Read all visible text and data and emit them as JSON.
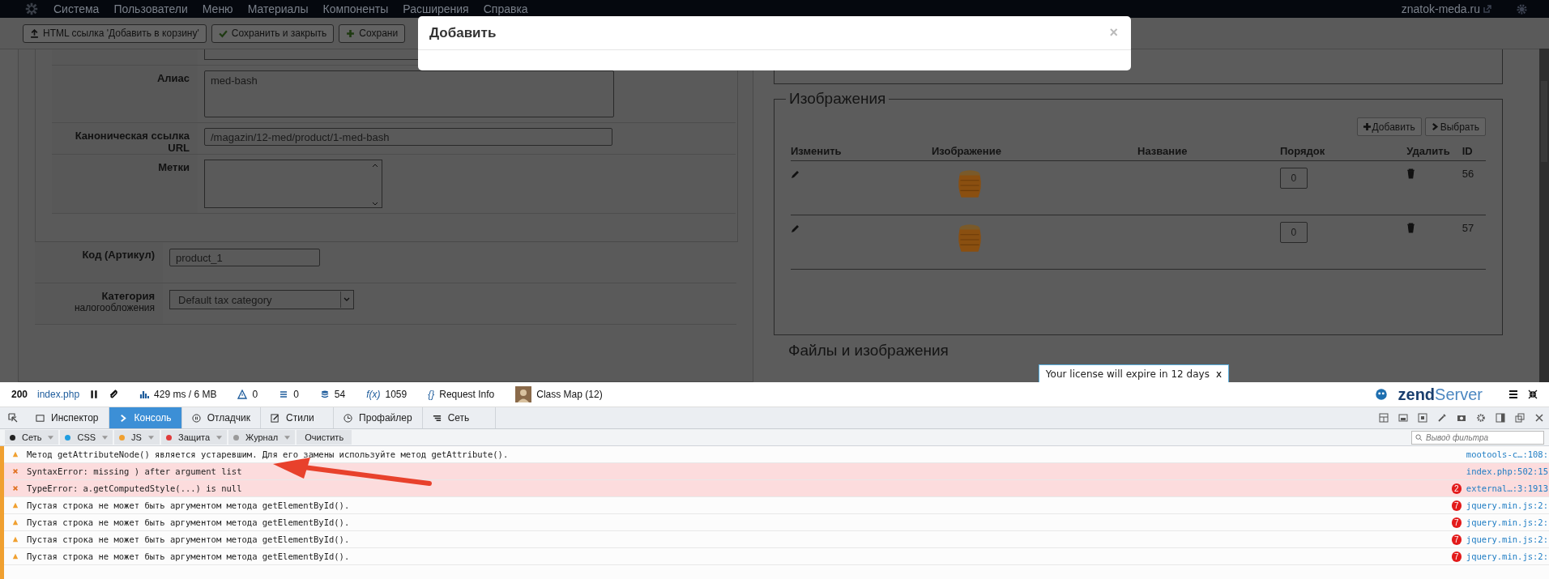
{
  "nav": {
    "menu": [
      "Система",
      "Пользователи",
      "Меню",
      "Материалы",
      "Компоненты",
      "Расширения",
      "Справка"
    ],
    "site": "znatok-meda.ru"
  },
  "toolbar": {
    "buttons": [
      {
        "kind": "upload",
        "label": "HTML ссылка 'Добавить в корзину'"
      },
      {
        "kind": "check",
        "label": "Сохранить и закрыть"
      },
      {
        "kind": "plus",
        "label": "Сохрани"
      }
    ]
  },
  "modal": {
    "title": "Добавить",
    "close": "×"
  },
  "form": {
    "inner_fields": [
      {
        "kind": "stub"
      },
      {
        "kind": "textarea",
        "label": "Алиас",
        "value": "med-bash"
      },
      {
        "kind": "input",
        "label": "Каноническая ссылка URL",
        "value": "/magazin/12-med/product/1-med-bash"
      },
      {
        "kind": "tags",
        "label": "Метки"
      }
    ],
    "fields": [
      {
        "kind": "input",
        "label": "Код (Артикул)",
        "value": "product_1"
      },
      {
        "kind": "select",
        "label": "Категория",
        "sublabel": "налогообложения",
        "value": "Default tax category"
      }
    ]
  },
  "images": {
    "legend": "Изображения",
    "buttons": [
      {
        "kind": "plus",
        "label": "Добавить"
      },
      {
        "kind": "chevron",
        "label": "Выбрать"
      }
    ],
    "columns": [
      "Изменить",
      "Изображение",
      "Название",
      "Порядок",
      "Удалить",
      "ID"
    ],
    "rows": [
      {
        "order": "0",
        "id": "56"
      },
      {
        "order": "0",
        "id": "57"
      }
    ]
  },
  "files_legend": "Файлы и изображения",
  "license_tip": {
    "text": "Your license will expire in 12 days",
    "close": "x"
  },
  "zend_bar": {
    "status": "200",
    "file": "index.php",
    "stats": [
      {
        "kind": "chart",
        "text": "429 ms / 6 MB"
      },
      {
        "kind": "warning",
        "text": "0"
      },
      {
        "kind": "list",
        "text": "0"
      },
      {
        "kind": "db",
        "text": "54"
      },
      {
        "kind": "fx",
        "icon_text": "f(x)",
        "text": "1059"
      },
      {
        "kind": "braces",
        "icon_text": "{}",
        "text": "Request Info"
      },
      {
        "kind": "avatar",
        "text": "Class Map (12)"
      }
    ],
    "logo_left": "zend",
    "logo_right": "Server"
  },
  "devtools": {
    "tabs": [
      {
        "kind": "inspector",
        "label": "Инспектор",
        "selected": false
      },
      {
        "kind": "console",
        "label": "Консоль",
        "selected": true
      },
      {
        "kind": "debug",
        "label": "Отладчик",
        "selected": false
      },
      {
        "kind": "style",
        "label": "Стили",
        "selected": false
      },
      {
        "kind": "profile",
        "label": "Профайлер",
        "selected": false
      },
      {
        "kind": "net",
        "label": "Сеть",
        "selected": false
      }
    ],
    "filters": [
      {
        "label": "Сеть",
        "color": "#222222"
      },
      {
        "label": "CSS",
        "color": "#1f9de0"
      },
      {
        "label": "JS",
        "color": "#f0a030"
      },
      {
        "label": "Защита",
        "color": "#e03b3b"
      },
      {
        "label": "Журнал",
        "color": "#9a9a9a"
      }
    ],
    "clear": "Очистить",
    "filter_placeholder": "Вывод фильтра",
    "messages": [
      {
        "kind": "warning",
        "text": "Метод getAttributeNode() является устаревшим. Для его замены используйте метод getAttribute().",
        "source": "mootools-c…:108:"
      },
      {
        "kind": "error",
        "text": "SyntaxError: missing ) after argument list",
        "source": "index.php:502:15"
      },
      {
        "kind": "error",
        "text": "TypeError: a.getComputedStyle(...) is null",
        "count": "2",
        "source": "external…:3:1913"
      },
      {
        "kind": "warning",
        "text": "Пустая строка не может быть аргументом метода getElementById().",
        "count": "7",
        "source": "jquery.min.js:2:"
      },
      {
        "kind": "warning",
        "text": "Пустая строка не может быть аргументом метода getElementById().",
        "count": "7",
        "source": "jquery.min.js:2:"
      },
      {
        "kind": "warning",
        "text": "Пустая строка не может быть аргументом метода getElementById().",
        "count": "7",
        "source": "jquery.min.js:2:"
      },
      {
        "kind": "warning",
        "text": "Пустая строка не может быть аргументом метода getElementById().",
        "count": "7",
        "source": "jquery.min.js:2:"
      }
    ]
  }
}
